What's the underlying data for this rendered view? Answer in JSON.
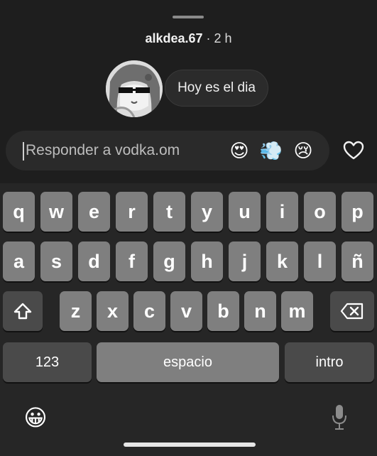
{
  "header": {
    "username": "alkdea.67",
    "time": " · 2 h"
  },
  "story": {
    "reply_preview": "Hoy es el dia"
  },
  "reply": {
    "placeholder": "Responder a vodka.om",
    "quick_reactions": [
      "😍",
      "💨",
      "😢"
    ]
  },
  "keyboard": {
    "row1": [
      "q",
      "w",
      "e",
      "r",
      "t",
      "y",
      "u",
      "i",
      "o",
      "p"
    ],
    "row2": [
      "a",
      "s",
      "d",
      "f",
      "g",
      "h",
      "j",
      "k",
      "l",
      "ñ"
    ],
    "row3": [
      "z",
      "x",
      "c",
      "v",
      "b",
      "n",
      "m"
    ],
    "numbers_label": "123",
    "space_label": "espacio",
    "return_label": "intro",
    "emoji_glyph": "😀"
  },
  "icons": {
    "heart": "heart-icon",
    "shift": "shift-icon",
    "backspace": "backspace-icon",
    "mic": "microphone-icon",
    "emoji": "emoji-icon"
  }
}
